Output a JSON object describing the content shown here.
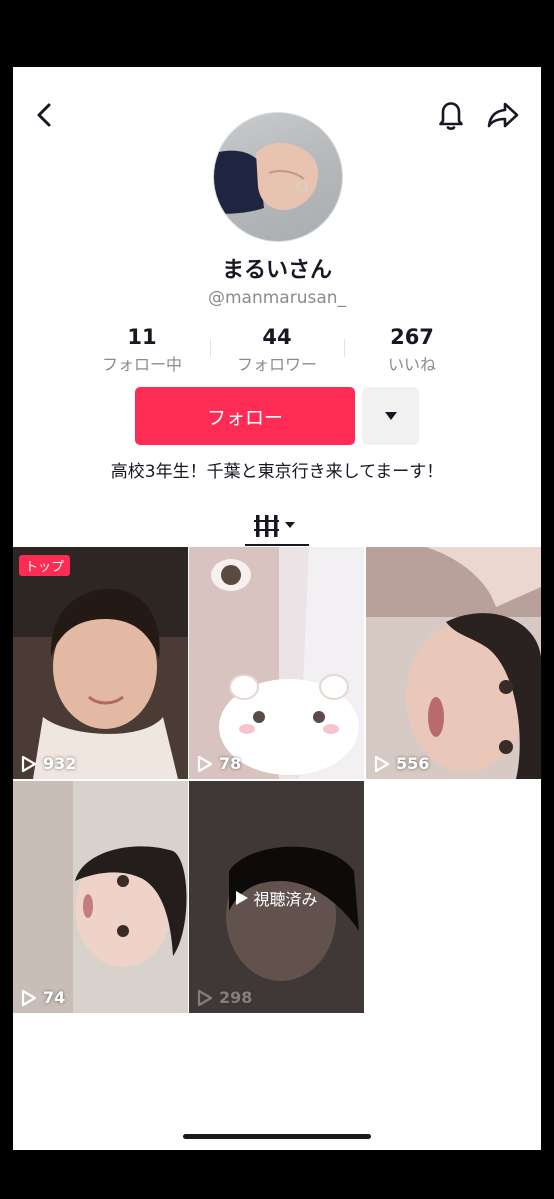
{
  "profile": {
    "display_name": "まるいさん",
    "username": "@manmarusan_",
    "bio": "高校3年生！千葉と東京行き来してまーす！"
  },
  "stats": [
    {
      "value": "11",
      "label": "フォロー中"
    },
    {
      "value": "44",
      "label": "フォロワー"
    },
    {
      "value": "267",
      "label": "いいね"
    }
  ],
  "actions": {
    "follow_label": "フォロー"
  },
  "videos": [
    {
      "views": "932",
      "badge": "トップ"
    },
    {
      "views": "78"
    },
    {
      "views": "556"
    },
    {
      "views": "74"
    },
    {
      "views": "298",
      "overlay": "視聴済み"
    }
  ],
  "colors": {
    "accent": "#fe2c55",
    "text": "#161823",
    "secondary_text": "#8a8b91"
  },
  "icons": [
    "back-arrow-icon",
    "bell-icon",
    "share-icon",
    "dropdown-caret-icon",
    "grid-view-icon",
    "play-icon"
  ]
}
